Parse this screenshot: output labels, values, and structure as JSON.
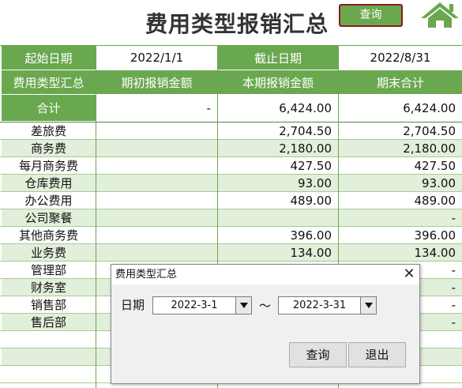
{
  "sheet": {
    "title": "费用类型报销汇总",
    "query_button": "查询",
    "home_icon": "home-icon",
    "start_date_label": "起始日期",
    "start_date_value": "2022/1/1",
    "end_date_label": "截止日期",
    "end_date_value": "2022/8/31",
    "columns": [
      "费用类型汇总",
      "期初报销金额",
      "本期报销金额",
      "期末合计"
    ],
    "total_row": {
      "label": "合计",
      "opening": "-",
      "current": "6,424.00",
      "closing": "6,424.00"
    },
    "rows": [
      {
        "type": "差旅费",
        "opening": "",
        "current": "2,704.50",
        "closing": "2,704.50"
      },
      {
        "type": "商务费",
        "opening": "",
        "current": "2,180.00",
        "closing": "2,180.00"
      },
      {
        "type": "每月商务费",
        "opening": "",
        "current": "427.50",
        "closing": "427.50"
      },
      {
        "type": "仓库费用",
        "opening": "",
        "current": "93.00",
        "closing": "93.00"
      },
      {
        "type": "办公费用",
        "opening": "",
        "current": "489.00",
        "closing": "489.00"
      },
      {
        "type": "公司聚餐",
        "opening": "",
        "current": "",
        "closing": "-"
      },
      {
        "type": "其他商务费",
        "opening": "",
        "current": "396.00",
        "closing": "396.00"
      },
      {
        "type": "业务费",
        "opening": "",
        "current": "134.00",
        "closing": "134.00"
      },
      {
        "type": "管理部",
        "opening": "",
        "current": "",
        "closing": "-"
      },
      {
        "type": "财务室",
        "opening": "",
        "current": "",
        "closing": "-"
      },
      {
        "type": "销售部",
        "opening": "",
        "current": "",
        "closing": "-"
      },
      {
        "type": "售后部",
        "opening": "",
        "current": "",
        "closing": "-"
      },
      {
        "type": "",
        "opening": "",
        "current": "",
        "closing": ""
      },
      {
        "type": "",
        "opening": "",
        "current": "",
        "closing": ""
      },
      {
        "type": "",
        "opening": "",
        "current": "",
        "closing": ""
      }
    ]
  },
  "dialog": {
    "title": "费用类型汇总",
    "close_glyph": "✕",
    "date_label": "日期",
    "from_date": "2022-3-1",
    "separator": "～",
    "to_date": "2022-3-31",
    "query_button": "查询",
    "exit_button": "退出"
  },
  "colors": {
    "header_green": "#6aa84f",
    "band_light": "#e2efda",
    "dialog_border": "#8b1a1a"
  }
}
